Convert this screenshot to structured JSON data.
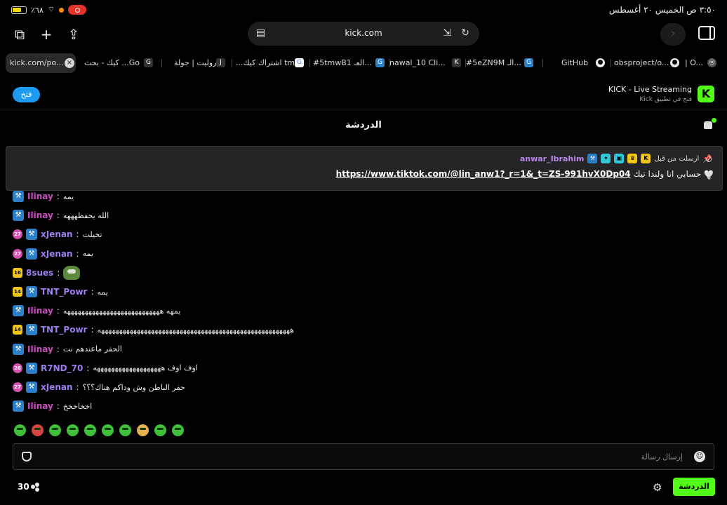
{
  "status_bar": {
    "battery_text": "٪٦٨",
    "datetime": "٣:٥٠ ص الخميس ٢٠ أغسطس"
  },
  "toolbar": {
    "url": "kick.com"
  },
  "tabs": [
    {
      "label": "kick.com/po...",
      "active": true
    },
    {
      "label": "كيك - بحث ...Go",
      "favicon": "G"
    },
    {
      "label": "روليت | جولة",
      "favicon": "J"
    },
    {
      "label": "...اشتراك كيك tm",
      "favicon": "G"
    },
    {
      "label": "#5tmwB1 العـ...",
      "favicon": "G"
    },
    {
      "label": "nawal_10 Cli...",
      "favicon": "K"
    },
    {
      "label": "#5eZN9M الـ...",
      "favicon": "G"
    },
    {
      "label": "GitHub",
      "favicon": "gh"
    },
    {
      "label": "obsproject/o...",
      "favicon": "gh"
    },
    {
      "label": "| O...",
      "favicon": "o"
    }
  ],
  "banner": {
    "open_label": "فتح",
    "app_title": "KICK - Live Streaming",
    "app_subtitle": "فتح في تطبيق Kick",
    "logo_letter": "K"
  },
  "chat": {
    "title": "الدردشة",
    "pinned": {
      "label": "ارسلت من قبل",
      "user": "anwar_Ibrahim",
      "prefix": "حسابي انا ولندا تيك",
      "link": "https://www.tiktok.com/@lin_anw1?_r=1&_t=ZS-991hvX0Dp04"
    },
    "messages": [
      {
        "user": "Ilinay",
        "text": "يمه",
        "color": "#c94fbf",
        "sub": null
      },
      {
        "user": "Ilinay",
        "text": "الله يحفظهههه",
        "color": "#c94fbf",
        "sub": null
      },
      {
        "user": "xJenan",
        "text": "تخيلت",
        "color": "#9d7ef0",
        "sub": "27"
      },
      {
        "user": "xJenan",
        "text": "يمه",
        "color": "#9d7ef0",
        "sub": "27"
      },
      {
        "user": "8sues",
        "text": "",
        "color": "#9d7ef0",
        "sub": "16",
        "emote": true
      },
      {
        "user": "TNT_Powr",
        "text": "يمه",
        "color": "#9d7ef0",
        "sub": "14"
      },
      {
        "user": "Ilinay",
        "text": "يمهه هههههههههههههههههههههههههههه",
        "color": "#c94fbf",
        "sub": null
      },
      {
        "user": "TNT_Powr",
        "text": "ههههههههههههههههههههههههههههههههههههههههههههههههههههههه",
        "color": "#9d7ef0",
        "sub": "14"
      },
      {
        "user": "Ilinay",
        "text": "الحفر ماعندهم نت",
        "color": "#c94fbf",
        "sub": null
      },
      {
        "user": "R7ND_70",
        "text": "اوف اوف هههههههههههههههههههه",
        "color": "#9d7ef0",
        "sub": "26"
      },
      {
        "user": "xJenan",
        "text": "حفر الباطن وش وداكم هناك؟؟؟",
        "color": "#9d7ef0",
        "sub": "27"
      },
      {
        "user": "Ilinay",
        "text": "اخخاخخخ",
        "color": "#c94fbf",
        "sub": null
      }
    ],
    "input_placeholder": "إرسال رسالة",
    "send_label": "الدردشة",
    "viewer_count": "30"
  },
  "colors": {
    "accent": "#53fc18",
    "blue": "#1d9bf0"
  }
}
